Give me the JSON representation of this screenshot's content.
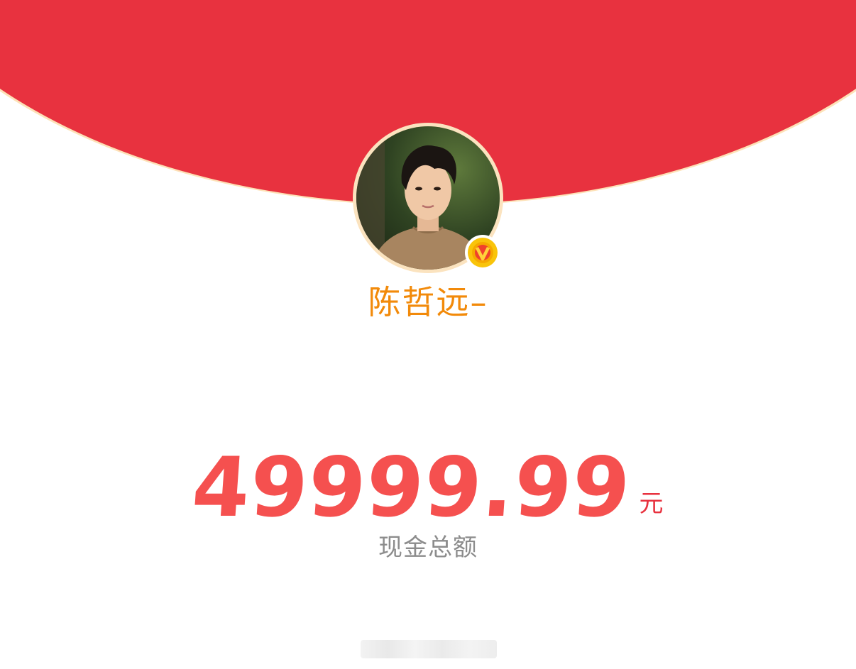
{
  "profile": {
    "name": "陈哲远–",
    "verified": true,
    "badge_icon": "verified-v-badge-icon",
    "avatar_icon": "user-avatar-photo"
  },
  "cash": {
    "amount": "49999.99",
    "unit": "元",
    "caption": "现金总额"
  },
  "colors": {
    "envelope_red": "#e8323f",
    "envelope_rim": "#fde2b8",
    "name_orange": "#f28a0a",
    "amount_red": "#f5504f",
    "caption_gray": "#8c8c8c"
  }
}
